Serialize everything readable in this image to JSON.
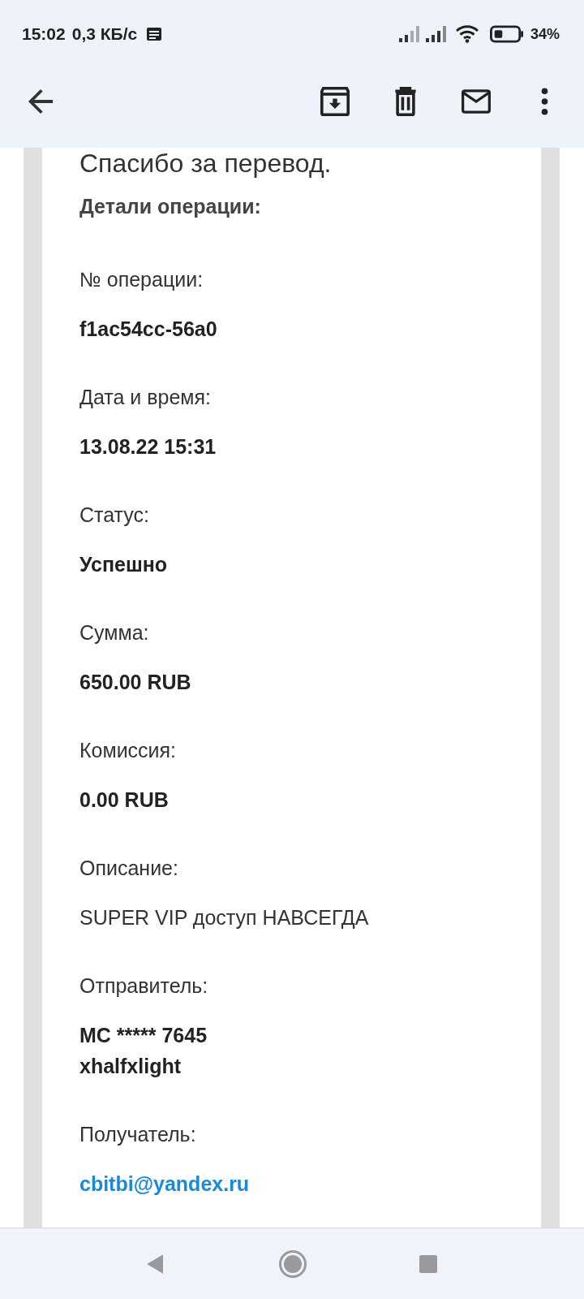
{
  "status_bar": {
    "time": "15:02",
    "speed": "0,3 КБ/с",
    "battery": "34%"
  },
  "message": {
    "title": "Спасибо за перевод.",
    "section_title": "Детали операции:",
    "fields": [
      {
        "label": "№ операции:",
        "kind": "bold",
        "lines": [
          "f1ac54cc-56a0"
        ]
      },
      {
        "label": "Дата и время:",
        "kind": "bold",
        "lines": [
          "13.08.22 15:31"
        ]
      },
      {
        "label": "Статус:",
        "kind": "bold",
        "lines": [
          "Успешно"
        ]
      },
      {
        "label": "Сумма:",
        "kind": "bold",
        "lines": [
          "650.00 RUB"
        ]
      },
      {
        "label": "Комиссия:",
        "kind": "bold",
        "lines": [
          "0.00 RUB"
        ]
      },
      {
        "label": "Описание:",
        "kind": "plain",
        "lines": [
          "SUPER VIP доступ НАВСЕГДА"
        ]
      },
      {
        "label": "Отправитель:",
        "kind": "bold",
        "lines": [
          "MC ***** 7645",
          "xhalfxlight"
        ]
      },
      {
        "label": "Получатель:",
        "kind": "link",
        "lines": [
          "cbitbi@yandex.ru"
        ]
      }
    ]
  }
}
